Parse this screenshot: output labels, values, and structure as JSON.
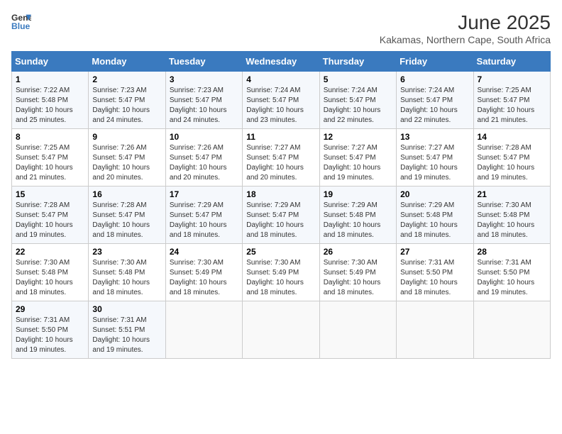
{
  "logo": {
    "text_general": "General",
    "text_blue": "Blue"
  },
  "title": "June 2025",
  "location": "Kakamas, Northern Cape, South Africa",
  "days_of_week": [
    "Sunday",
    "Monday",
    "Tuesday",
    "Wednesday",
    "Thursday",
    "Friday",
    "Saturday"
  ],
  "weeks": [
    [
      {
        "day": "1",
        "lines": [
          "Sunrise: 7:22 AM",
          "Sunset: 5:48 PM",
          "Daylight: 10 hours",
          "and 25 minutes."
        ]
      },
      {
        "day": "2",
        "lines": [
          "Sunrise: 7:23 AM",
          "Sunset: 5:47 PM",
          "Daylight: 10 hours",
          "and 24 minutes."
        ]
      },
      {
        "day": "3",
        "lines": [
          "Sunrise: 7:23 AM",
          "Sunset: 5:47 PM",
          "Daylight: 10 hours",
          "and 24 minutes."
        ]
      },
      {
        "day": "4",
        "lines": [
          "Sunrise: 7:24 AM",
          "Sunset: 5:47 PM",
          "Daylight: 10 hours",
          "and 23 minutes."
        ]
      },
      {
        "day": "5",
        "lines": [
          "Sunrise: 7:24 AM",
          "Sunset: 5:47 PM",
          "Daylight: 10 hours",
          "and 22 minutes."
        ]
      },
      {
        "day": "6",
        "lines": [
          "Sunrise: 7:24 AM",
          "Sunset: 5:47 PM",
          "Daylight: 10 hours",
          "and 22 minutes."
        ]
      },
      {
        "day": "7",
        "lines": [
          "Sunrise: 7:25 AM",
          "Sunset: 5:47 PM",
          "Daylight: 10 hours",
          "and 21 minutes."
        ]
      }
    ],
    [
      {
        "day": "8",
        "lines": [
          "Sunrise: 7:25 AM",
          "Sunset: 5:47 PM",
          "Daylight: 10 hours",
          "and 21 minutes."
        ]
      },
      {
        "day": "9",
        "lines": [
          "Sunrise: 7:26 AM",
          "Sunset: 5:47 PM",
          "Daylight: 10 hours",
          "and 20 minutes."
        ]
      },
      {
        "day": "10",
        "lines": [
          "Sunrise: 7:26 AM",
          "Sunset: 5:47 PM",
          "Daylight: 10 hours",
          "and 20 minutes."
        ]
      },
      {
        "day": "11",
        "lines": [
          "Sunrise: 7:27 AM",
          "Sunset: 5:47 PM",
          "Daylight: 10 hours",
          "and 20 minutes."
        ]
      },
      {
        "day": "12",
        "lines": [
          "Sunrise: 7:27 AM",
          "Sunset: 5:47 PM",
          "Daylight: 10 hours",
          "and 19 minutes."
        ]
      },
      {
        "day": "13",
        "lines": [
          "Sunrise: 7:27 AM",
          "Sunset: 5:47 PM",
          "Daylight: 10 hours",
          "and 19 minutes."
        ]
      },
      {
        "day": "14",
        "lines": [
          "Sunrise: 7:28 AM",
          "Sunset: 5:47 PM",
          "Daylight: 10 hours",
          "and 19 minutes."
        ]
      }
    ],
    [
      {
        "day": "15",
        "lines": [
          "Sunrise: 7:28 AM",
          "Sunset: 5:47 PM",
          "Daylight: 10 hours",
          "and 19 minutes."
        ]
      },
      {
        "day": "16",
        "lines": [
          "Sunrise: 7:28 AM",
          "Sunset: 5:47 PM",
          "Daylight: 10 hours",
          "and 18 minutes."
        ]
      },
      {
        "day": "17",
        "lines": [
          "Sunrise: 7:29 AM",
          "Sunset: 5:47 PM",
          "Daylight: 10 hours",
          "and 18 minutes."
        ]
      },
      {
        "day": "18",
        "lines": [
          "Sunrise: 7:29 AM",
          "Sunset: 5:47 PM",
          "Daylight: 10 hours",
          "and 18 minutes."
        ]
      },
      {
        "day": "19",
        "lines": [
          "Sunrise: 7:29 AM",
          "Sunset: 5:48 PM",
          "Daylight: 10 hours",
          "and 18 minutes."
        ]
      },
      {
        "day": "20",
        "lines": [
          "Sunrise: 7:29 AM",
          "Sunset: 5:48 PM",
          "Daylight: 10 hours",
          "and 18 minutes."
        ]
      },
      {
        "day": "21",
        "lines": [
          "Sunrise: 7:30 AM",
          "Sunset: 5:48 PM",
          "Daylight: 10 hours",
          "and 18 minutes."
        ]
      }
    ],
    [
      {
        "day": "22",
        "lines": [
          "Sunrise: 7:30 AM",
          "Sunset: 5:48 PM",
          "Daylight: 10 hours",
          "and 18 minutes."
        ]
      },
      {
        "day": "23",
        "lines": [
          "Sunrise: 7:30 AM",
          "Sunset: 5:48 PM",
          "Daylight: 10 hours",
          "and 18 minutes."
        ]
      },
      {
        "day": "24",
        "lines": [
          "Sunrise: 7:30 AM",
          "Sunset: 5:49 PM",
          "Daylight: 10 hours",
          "and 18 minutes."
        ]
      },
      {
        "day": "25",
        "lines": [
          "Sunrise: 7:30 AM",
          "Sunset: 5:49 PM",
          "Daylight: 10 hours",
          "and 18 minutes."
        ]
      },
      {
        "day": "26",
        "lines": [
          "Sunrise: 7:30 AM",
          "Sunset: 5:49 PM",
          "Daylight: 10 hours",
          "and 18 minutes."
        ]
      },
      {
        "day": "27",
        "lines": [
          "Sunrise: 7:31 AM",
          "Sunset: 5:50 PM",
          "Daylight: 10 hours",
          "and 18 minutes."
        ]
      },
      {
        "day": "28",
        "lines": [
          "Sunrise: 7:31 AM",
          "Sunset: 5:50 PM",
          "Daylight: 10 hours",
          "and 19 minutes."
        ]
      }
    ],
    [
      {
        "day": "29",
        "lines": [
          "Sunrise: 7:31 AM",
          "Sunset: 5:50 PM",
          "Daylight: 10 hours",
          "and 19 minutes."
        ]
      },
      {
        "day": "30",
        "lines": [
          "Sunrise: 7:31 AM",
          "Sunset: 5:51 PM",
          "Daylight: 10 hours",
          "and 19 minutes."
        ]
      },
      {
        "day": "",
        "lines": []
      },
      {
        "day": "",
        "lines": []
      },
      {
        "day": "",
        "lines": []
      },
      {
        "day": "",
        "lines": []
      },
      {
        "day": "",
        "lines": []
      }
    ]
  ]
}
